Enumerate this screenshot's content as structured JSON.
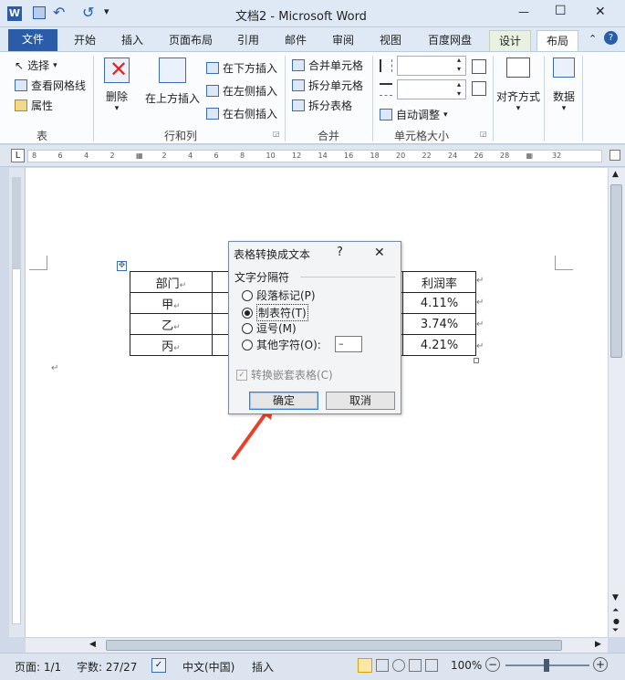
{
  "window": {
    "title": "文档2 - Microsoft Word",
    "qat_word_icon": "word-icon",
    "controls": {
      "minimize": "—",
      "maximize": "☐",
      "close": "✕"
    }
  },
  "tabs": [
    "文件",
    "开始",
    "插入",
    "页面布局",
    "引用",
    "邮件",
    "审阅",
    "视图",
    "百度网盘",
    "设计",
    "布局"
  ],
  "ribbon": {
    "table_group": {
      "label": "表",
      "select": "选择",
      "gridlines": "查看网格线",
      "properties": "属性"
    },
    "rows_cols_group": {
      "label": "行和列",
      "delete": "删除",
      "insert_above": "在上方插入",
      "insert_below": "在下方插入",
      "insert_left": "在左侧插入",
      "insert_right": "在右侧插入"
    },
    "merge_group": {
      "label": "合并",
      "merge_cells": "合并单元格",
      "split_cells": "拆分单元格",
      "split_table": "拆分表格"
    },
    "cell_size_group": {
      "label": "单元格大小",
      "autofit": "自动调整"
    },
    "alignment": "对齐方式",
    "data": "数据"
  },
  "ruler": {
    "h_ticks": [
      "8",
      "6",
      "4",
      "2",
      "",
      "2",
      "4",
      "6",
      "8",
      "10",
      "12",
      "14",
      "16",
      "18",
      "20",
      "22",
      "24",
      "26",
      "28",
      "",
      "32"
    ]
  },
  "document": {
    "table": [
      {
        "dept": "部门",
        "rate": "利润率"
      },
      {
        "dept": "甲",
        "rate": "4.11%"
      },
      {
        "dept": "乙",
        "rate": "3.74%"
      },
      {
        "dept": "丙",
        "rate": "4.21%"
      }
    ],
    "cell_mark": "↵"
  },
  "dialog": {
    "title": "表格转换成文本",
    "help": "?",
    "close": "✕",
    "group_label": "文字分隔符",
    "options": [
      {
        "label": "段落标记(P)",
        "selected": false
      },
      {
        "label": "制表符(T)",
        "selected": true
      },
      {
        "label": "逗号(M)",
        "selected": false
      },
      {
        "label": "其他字符(O):",
        "selected": false
      }
    ],
    "other_char_value": "–",
    "nested_checkbox": "转换嵌套表格(C)",
    "ok": "确定",
    "cancel": "取消"
  },
  "status": {
    "page": "页面: 1/1",
    "words": "字数: 27/27",
    "language": "中文(中国)",
    "insert_mode": "插入",
    "zoom": "100%",
    "zoom_out": "−",
    "zoom_in": "+"
  },
  "colors": {
    "file_tab": "#2a5ca8",
    "arrow": "#e8412b",
    "context_tab_bg": "#e9f1e0"
  }
}
